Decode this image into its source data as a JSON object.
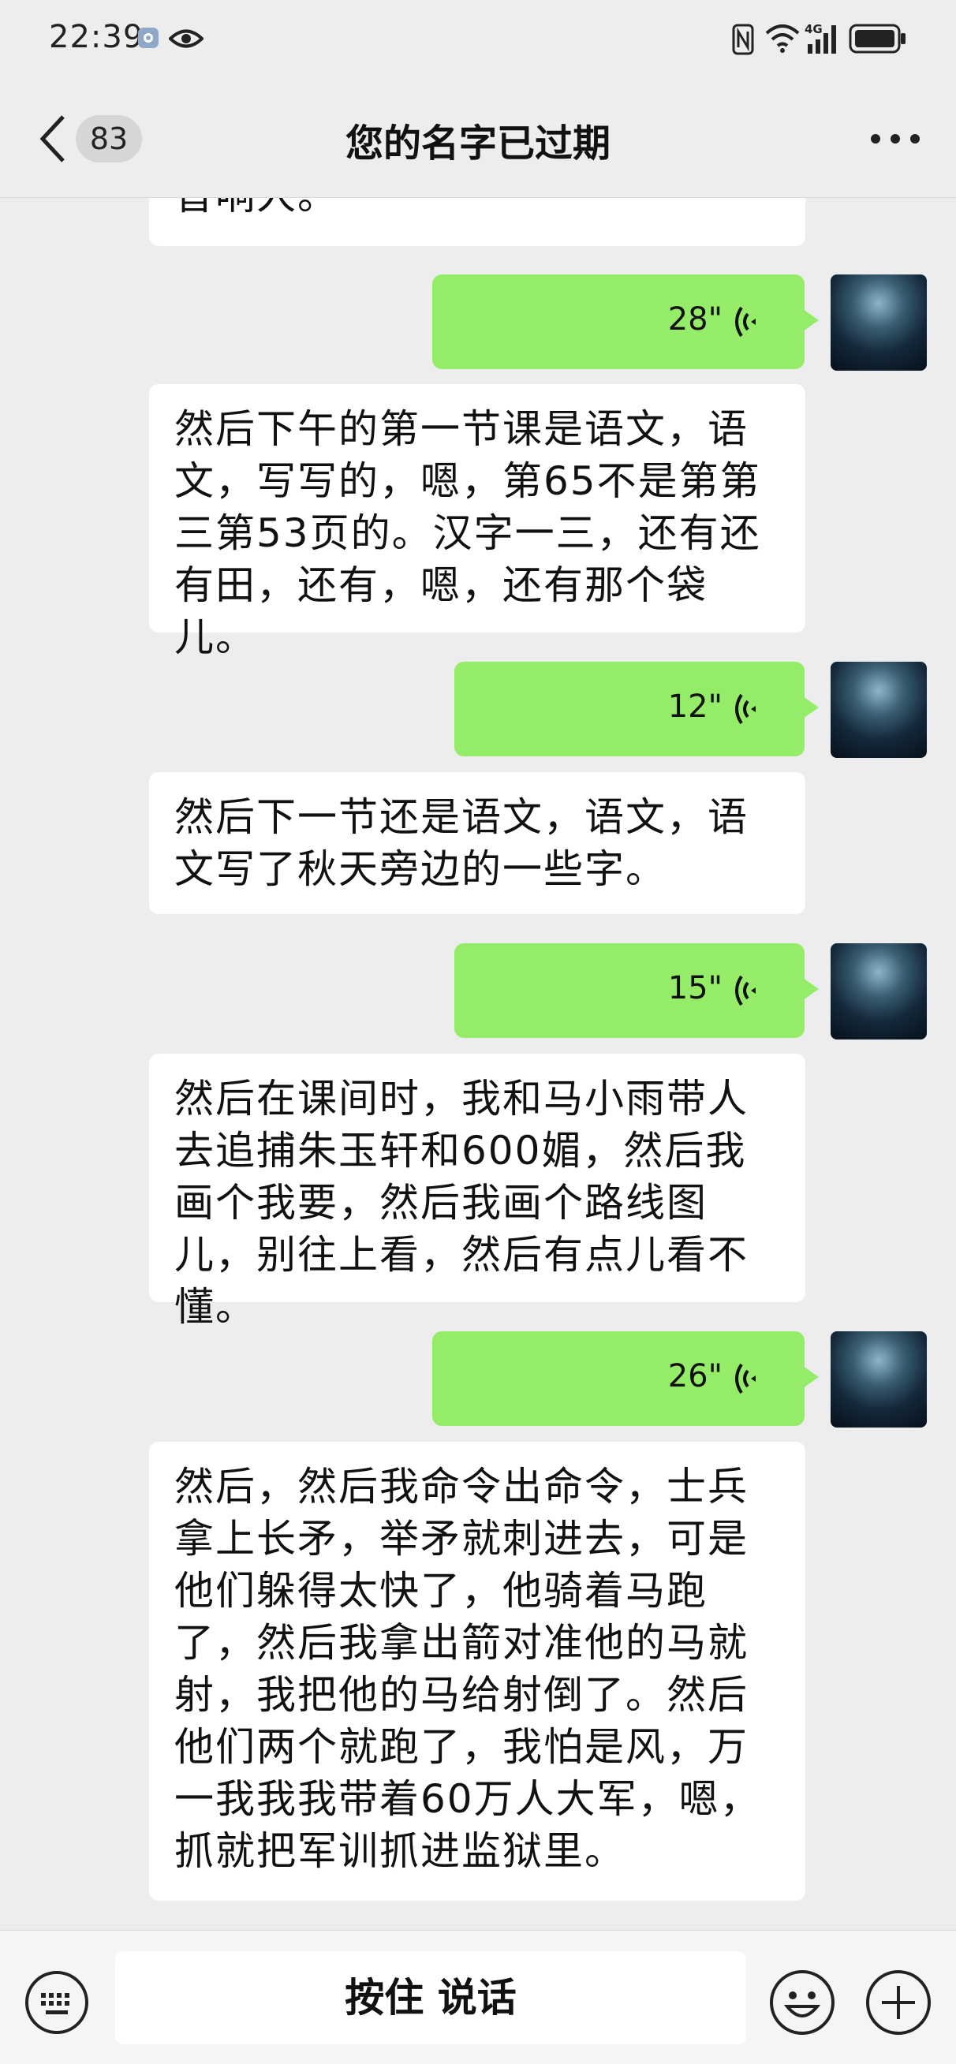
{
  "status_bar": {
    "time": "22:39",
    "icons": [
      "app-notification-icon",
      "eye-icon",
      "nfc-icon",
      "wifi-icon",
      "4g-signal-icon",
      "battery-icon"
    ],
    "network_label": "4G"
  },
  "header": {
    "back_icon": "chevron-left-icon",
    "unread_count": "83",
    "title": "您的名字已过期",
    "more_icon": "more-dots-icon"
  },
  "messages": [
    {
      "type": "text",
      "side": "left",
      "text": "音响人。"
    },
    {
      "type": "voice",
      "side": "right",
      "duration": "28\""
    },
    {
      "type": "text",
      "side": "left",
      "text": "然后下午的第一节课是语文，语文，写写的，嗯，第65不是第第三第53页的。汉字一三，还有还有田，还有，嗯，还有那个袋儿。"
    },
    {
      "type": "voice",
      "side": "right",
      "duration": "12\""
    },
    {
      "type": "text",
      "side": "left",
      "text": "然后下一节还是语文，语文，语文写了秋天旁边的一些字。"
    },
    {
      "type": "voice",
      "side": "right",
      "duration": "15\""
    },
    {
      "type": "text",
      "side": "left",
      "text": "然后在课间时，我和马小雨带人去追捕朱玉轩和600媚，然后我画个我要，然后我画个路线图儿，别往上看，然后有点儿看不懂。"
    },
    {
      "type": "voice",
      "side": "right",
      "duration": "26\""
    },
    {
      "type": "text",
      "side": "left",
      "text": "然后，然后我命令出命令，士兵拿上长矛，举矛就刺进去，可是他们躲得太快了，他骑着马跑了，然后我拿出箭对准他的马就射，我把他的马给射倒了。然后他们两个就跑了，我怕是风，万一我我我带着60万人大军，嗯，抓就把军训抓进监狱里。"
    }
  ],
  "input_bar": {
    "keyboard_icon": "keyboard-icon",
    "hold_to_talk_label": "按住 说话",
    "emoji_icon": "emoji-icon",
    "plus_icon": "plus-icon"
  },
  "colors": {
    "background": "#ededed",
    "voice_bubble": "#95ec69",
    "text_bubble": "#ffffff"
  }
}
